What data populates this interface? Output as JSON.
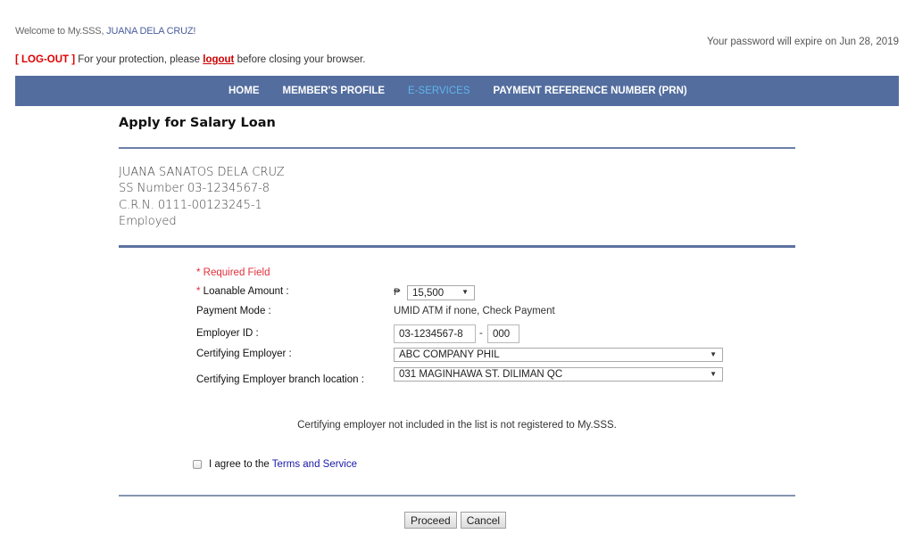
{
  "header": {
    "welcome_prefix": "Welcome to My.SSS, ",
    "welcome_name": "JUANA DELA CRUZ!",
    "password_notice": "Your password will expire on Jun 28, 2019",
    "logout_tag": "[ LOG-OUT ]",
    "logout_text_before": " For your protection, please ",
    "logout_link": "logout",
    "logout_text_after": " before closing your browser."
  },
  "nav": {
    "items": [
      {
        "label": "HOME",
        "active": false
      },
      {
        "label": "MEMBER'S PROFILE",
        "active": false
      },
      {
        "label": "E-SERVICES",
        "active": true
      },
      {
        "label": "PAYMENT REFERENCE NUMBER (PRN)",
        "active": false
      }
    ],
    "bar_color": "#536d9e",
    "active_color": "#5fb5ee"
  },
  "page": {
    "title": "Apply for Salary Loan"
  },
  "member": {
    "name": "JUANA SANATOS DELA CRUZ",
    "ss_number": "SS Number 03-1234567-8",
    "crn": "C.R.N. 0111-00123245-1",
    "status": "Employed"
  },
  "form": {
    "required_note": "* Required Field",
    "loanable_amount": {
      "asterisk": "*",
      "label": " Loanable Amount :",
      "currency": "₱",
      "selected": "15,500"
    },
    "payment_mode": {
      "label": "Payment Mode :",
      "value": "UMID ATM if none, Check Payment"
    },
    "employer_id": {
      "label": "Employer ID :",
      "id_value": "03-1234567-8",
      "separator": "-",
      "branch_value": "000"
    },
    "certifying_employer": {
      "label": "Certifying Employer :",
      "selected": "ABC COMPANY PHIL"
    },
    "branch_location": {
      "label": "Certifying Employer branch location :",
      "selected": "031 MAGINHAWA ST. DILIMAN QC"
    },
    "notice": "Certifying employer not included in the list is not registered to My.SSS.",
    "agree_text": "I agree to the",
    "terms_link": "Terms and Service",
    "agree_checked": false
  },
  "actions": {
    "proceed": "Proceed",
    "cancel": "Cancel"
  }
}
